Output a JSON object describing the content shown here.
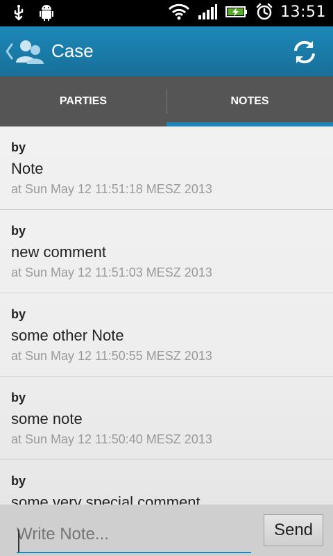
{
  "status_bar": {
    "time": "13:51"
  },
  "action_bar": {
    "title": "Case",
    "icons": {
      "back": "chevron-left-icon",
      "case": "people-icon",
      "refresh": "refresh-icon"
    }
  },
  "tabs": [
    {
      "label": "PARTIES",
      "active": false
    },
    {
      "label": "NOTES",
      "active": true
    }
  ],
  "notes": [
    {
      "by": "by",
      "text": "Note",
      "time": "at Sun May 12 11:51:18 MESZ 2013"
    },
    {
      "by": "by",
      "text": "new comment",
      "time": "at Sun May 12 11:51:03 MESZ 2013"
    },
    {
      "by": "by",
      "text": "some other Note",
      "time": "at Sun May 12 11:50:55 MESZ 2013"
    },
    {
      "by": "by",
      "text": "some note",
      "time": "at Sun May 12 11:50:40 MESZ 2013"
    },
    {
      "by": "by",
      "text": "some very special comment",
      "time": ""
    }
  ],
  "composer": {
    "placeholder": "Write Note...",
    "value": "",
    "send_label": "Send"
  },
  "colors": {
    "accent": "#1d88b8",
    "tabbar": "#555555"
  }
}
